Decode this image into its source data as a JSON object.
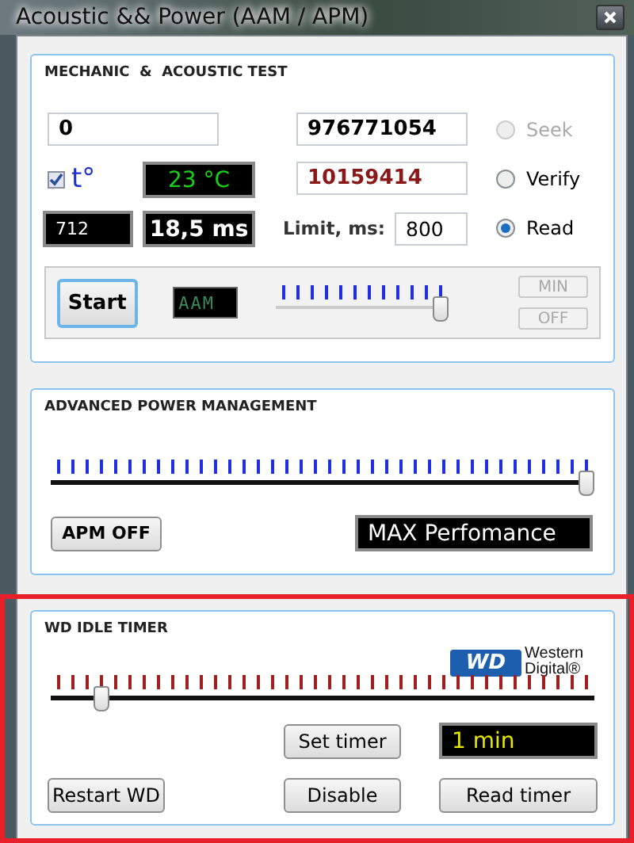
{
  "window": {
    "title": "Acoustic && Power (AAM / APM)"
  },
  "mechanic_test": {
    "title": "MECHANIC  &  ACOUSTIC TEST",
    "start_lba": "0",
    "end_lba": "976771054",
    "current_lba": "10159414",
    "temperature": {
      "label": "t°",
      "checked": true,
      "reading": "23 °C"
    },
    "counter": "712",
    "time": "18,5 ms",
    "limit": {
      "label": "Limit, ms:",
      "value": "800"
    },
    "modes": [
      {
        "label": "Seek",
        "selected": false,
        "disabled": true
      },
      {
        "label": "Verify",
        "selected": false,
        "disabled": false
      },
      {
        "label": "Read",
        "selected": true,
        "disabled": false
      }
    ],
    "start_button": "Start",
    "aam_display": "AAM",
    "aam_slider": {
      "level": 1
    },
    "side_buttons": [
      {
        "label": "MIN",
        "disabled": true
      },
      {
        "label": "OFF",
        "disabled": true
      }
    ]
  },
  "apm": {
    "title": "ADVANCED POWER MANAGEMENT",
    "slider": {
      "level": 1
    },
    "off_button": "APM OFF",
    "display": "MAX Perfomance"
  },
  "wd_idle_timer": {
    "title": "WD IDLE TIMER",
    "logo": {
      "mark": "WD",
      "name": "Western Digital®"
    },
    "slider": {
      "level": 0.08
    },
    "set_button": "Set timer",
    "display": "1 min",
    "buttons": [
      "Restart WD",
      "Disable",
      "Read timer"
    ]
  }
}
